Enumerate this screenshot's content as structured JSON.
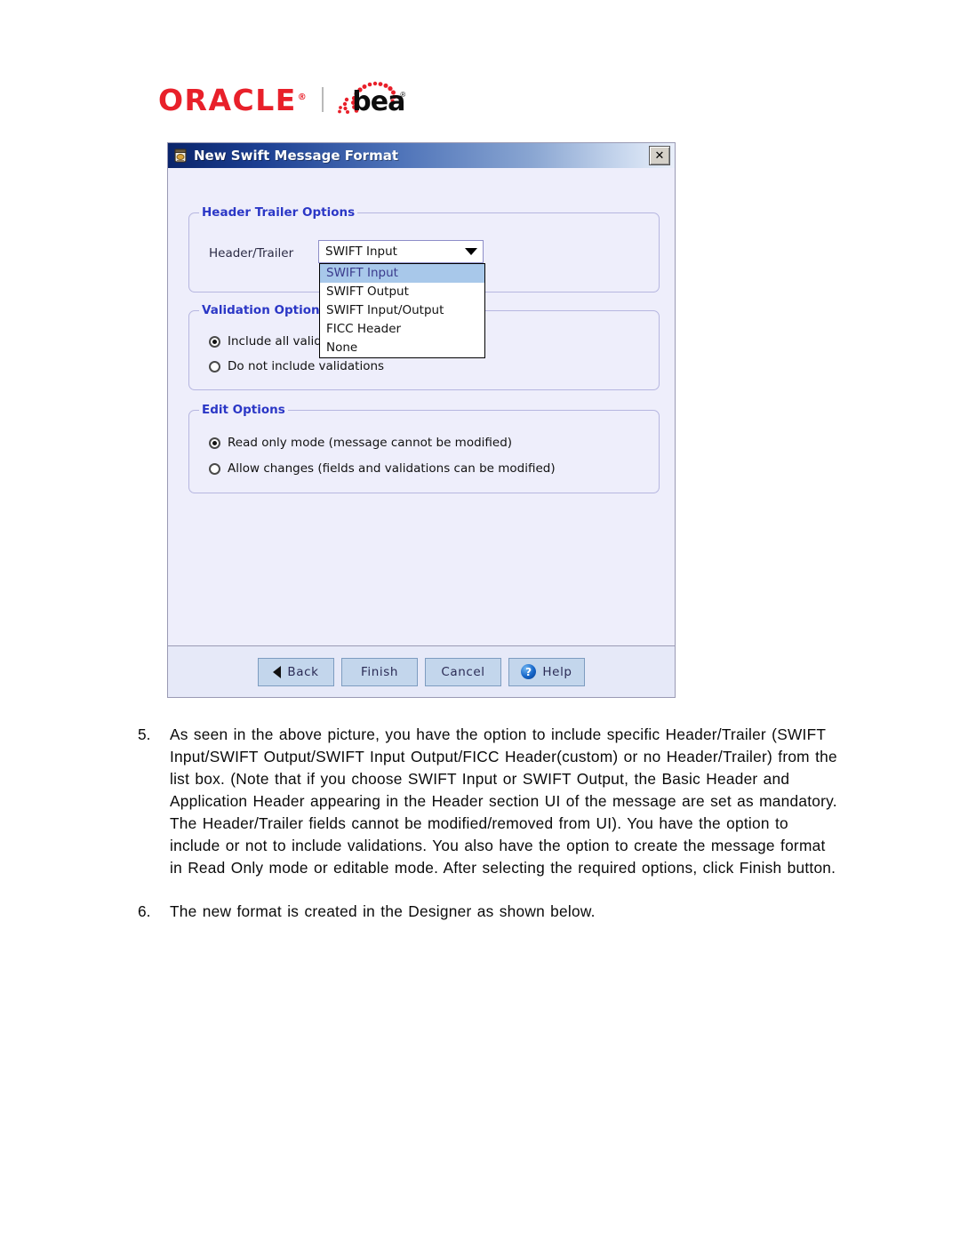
{
  "logo": {
    "oracle": "ORACLE",
    "oracle_reg": "®",
    "bea": "bea",
    "bea_reg": "®"
  },
  "dialog": {
    "title": "New Swift Message Format",
    "title_icon": "message-format-icon",
    "close_label": "✕",
    "groups": {
      "header_trailer": {
        "legend": "Header Trailer Options",
        "field_label": "Header/Trailer",
        "combo": {
          "value": "SWIFT Input",
          "arrow_icon": "chevron-down-icon",
          "options": [
            "SWIFT Input",
            "SWIFT Output",
            "SWIFT Input/Output",
            "FICC Header",
            "None"
          ],
          "selected_index": 0,
          "expanded": true
        }
      },
      "validation": {
        "legend": "Validation Options",
        "options": [
          {
            "label": "Include all validations",
            "checked": true
          },
          {
            "label": "Do not include validations",
            "checked": false
          }
        ]
      },
      "edit": {
        "legend": "Edit Options",
        "options": [
          {
            "label": "Read only mode (message cannot be modified)",
            "checked": true
          },
          {
            "label": "Allow changes (fields and validations can be modified)",
            "checked": false
          }
        ]
      }
    },
    "buttons": [
      {
        "label": "Back",
        "icon": "back-arrow-icon"
      },
      {
        "label": "Finish",
        "icon": ""
      },
      {
        "label": "Cancel",
        "icon": ""
      },
      {
        "label": "Help",
        "icon": "help-question-icon"
      }
    ]
  },
  "prose": [
    {
      "number": "5.",
      "text": "As seen in the above picture, you have the option to include specific Header/Trailer (SWIFT Input/SWIFT Output/SWIFT Input Output/FICC Header(custom) or no Header/Trailer) from the list box. (Note that if you choose SWIFT Input or SWIFT Output, the Basic Header and Application Header appearing in the Header section UI of the message are set as mandatory. The Header/Trailer fields cannot be modified/removed from UI).  You have the option to include or not to include validations.  You also have the option to create the message format in Read Only mode or editable mode.  After selecting the required options, click Finish button."
    },
    {
      "number": "6.",
      "text": "The new format is created in the Designer as shown below."
    }
  ]
}
